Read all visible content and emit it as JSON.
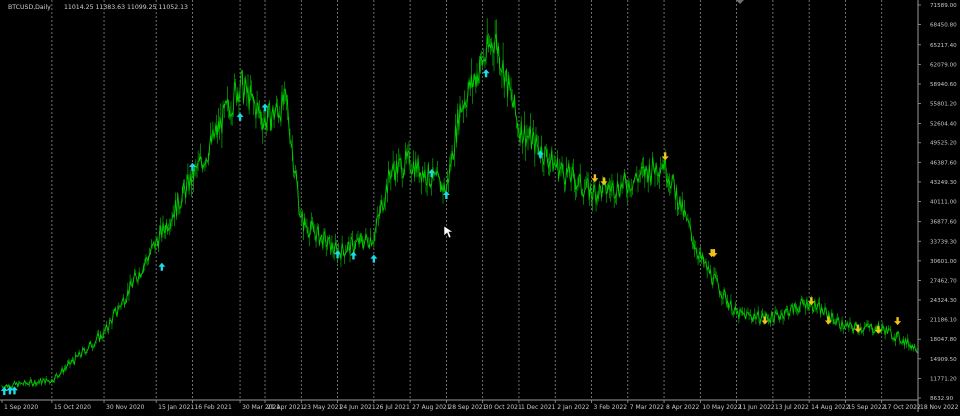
{
  "header": {
    "symbol": "BTCUSD,Daily",
    "ohlc": "11014.25 11383.63 11099.25 11052.13"
  },
  "colors": {
    "background": "#000000",
    "candle": "#00cc00",
    "grid": "#8a8a8a",
    "axis_text": "#c8c8c8",
    "up_arrow": "#20d8e8",
    "down_arrow": "#f2c21b"
  },
  "chart_data": {
    "type": "line",
    "title": "",
    "xlabel": "",
    "ylabel": "",
    "ylim": [
      8632.9,
      71589.0
    ],
    "y_ticks": [
      "71589.00",
      "68450.80",
      "65217.40",
      "62079.00",
      "58940.60",
      "55801.20",
      "52604.40",
      "49525.20",
      "46387.60",
      "43249.30",
      "40111.00",
      "36877.60",
      "33739.30",
      "30601.00",
      "27462.70",
      "24324.30",
      "21186.10",
      "18047.80",
      "14909.50",
      "11771.20",
      "8632.90"
    ],
    "x_ticks": [
      "1 Sep 2020",
      "15 Oct 2020",
      "30 Nov 2020",
      "15 Jan 2021",
      "16 Feb 2021",
      "30 Mar 2021",
      "21 Apr 2021",
      "23 May 2021",
      "24 Jun 2021",
      "26 Jul 2021",
      "27 Aug 2021",
      "28 Sep 2021",
      "30 Oct 2021",
      "1 Dec 2021",
      "2 Jan 2022",
      "3 Feb 2022",
      "7 Mar 2022",
      "8 Apr 2022",
      "10 May 2022",
      "11 Jun 2022",
      "13 Jul 2022",
      "14 Aug 2022",
      "15 Sep 2022",
      "17 Oct 2022",
      "18 Nov 2022"
    ],
    "series": [
      {
        "x": [
          "1 Sep 2020",
          "15 Oct 2020",
          "30 Nov 2020",
          "15 Jan 2021",
          "16 Feb 2021",
          "1 Mar 2021",
          "30 Mar 2021",
          "21 Apr 2021",
          "10 May 2021",
          "23 May 2021",
          "24 Jun 2021",
          "26 Jul 2021",
          "10 Aug 2021",
          "27 Aug 2021",
          "28 Sep 2021",
          "10 Oct 2021",
          "30 Oct 2021",
          "10 Nov 2021",
          "1 Dec 2021",
          "2 Jan 2022",
          "3 Feb 2022",
          "7 Mar 2022",
          "8 Apr 2022",
          "10 May 2022",
          "11 Jun 2022",
          "13 Jul 2022",
          "14 Aug 2022",
          "15 Sep 2022",
          "17 Oct 2022",
          "18 Nov 2022"
        ],
        "values": [
          10500,
          11500,
          19000,
          33500,
          44000,
          48000,
          59000,
          53000,
          56000,
          37000,
          32000,
          34500,
          45000,
          46500,
          42000,
          55000,
          62500,
          66500,
          52000,
          46000,
          41500,
          43000,
          46500,
          31000,
          22000,
          21500,
          24000,
          20000,
          19800,
          16500
        ]
      }
    ],
    "up_arrows": [
      {
        "date": "3 Sep 2020",
        "price": 9600
      },
      {
        "date": "8 Sep 2020",
        "price": 9700
      },
      {
        "date": "12 Sep 2020",
        "price": 9700
      },
      {
        "date": "20 Jan 2021",
        "price": 29500
      },
      {
        "date": "16 Feb 2021",
        "price": 45500
      },
      {
        "date": "30 Mar 2021",
        "price": 53500
      },
      {
        "date": "21 Apr 2021",
        "price": 55000
      },
      {
        "date": "24 Jun 2021",
        "price": 31500
      },
      {
        "date": "8 Jul 2021",
        "price": 31300
      },
      {
        "date": "26 Jul 2021",
        "price": 30800
      },
      {
        "date": "15 Sep 2021",
        "price": 44500
      },
      {
        "date": "28 Sep 2021",
        "price": 41000
      },
      {
        "date": "2 Nov 2021",
        "price": 60500
      },
      {
        "date": "20 Dec 2021",
        "price": 47500
      }
    ],
    "down_arrows": [
      {
        "date": "6 Feb 2022",
        "price": 44000
      },
      {
        "date": "14 Feb 2022",
        "price": 43500
      },
      {
        "date": "9 Apr 2022",
        "price": 47500
      },
      {
        "date": "20 May 2022",
        "price": 32000
      },
      {
        "date": "22 May 2022",
        "price": 32000
      },
      {
        "date": "6 Jul 2022",
        "price": 21200
      },
      {
        "date": "16 Aug 2022",
        "price": 24300
      },
      {
        "date": "31 Aug 2022",
        "price": 21200
      },
      {
        "date": "26 Sep 2022",
        "price": 19900
      },
      {
        "date": "14 Oct 2022",
        "price": 19700
      },
      {
        "date": "31 Oct 2022",
        "price": 21100
      }
    ],
    "grid": "vertical dotted"
  }
}
